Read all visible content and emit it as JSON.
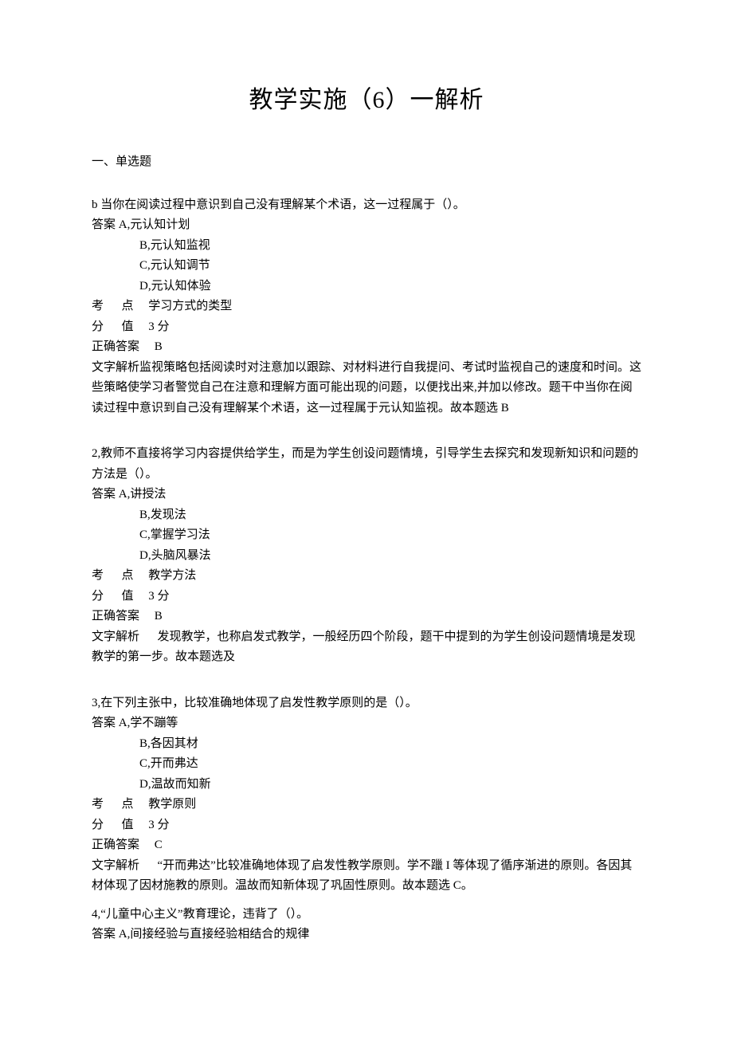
{
  "title": "教学实施（6）一解析",
  "section_header": "一、单选题",
  "questions": [
    {
      "stem": "b 当你在阅读过程中意识到自己没有理解某个术语，这一过程属于（）。",
      "opt_a": "答案 A,元认知计划",
      "opt_b": "B,元认知监视",
      "opt_c": "C,元认知调节",
      "opt_d": "D,元认知体验",
      "kaodian_label": "考",
      "kaodian_label2": "点",
      "kaodian": "学习方式的类型",
      "fenzhi_label": "分",
      "fenzhi_label2": "值",
      "fenzhi": "3 分",
      "answer_label": "正确答案",
      "answer": "B",
      "analysis": "文字解析监视策略包括阅读时对注意加以跟踪、对材料进行自我提问、考试时监视自己的速度和时间。这些策略使学习者警觉自己在注意和理解方面可能出现的问题，以便找出来,并加以修改。题干中当你在阅读过程中意识到自己没有理解某个术语，这一过程属于元认知监视。故本题选 B"
    },
    {
      "stem": "2,教师不直接将学习内容提供给学生，而是为学生创设问题情境，引导学生去探究和发现新知识和问题的方法是（）。",
      "opt_a": "答案 A,讲授法",
      "opt_b": "B,发现法",
      "opt_c": "C,掌握学习法",
      "opt_d": "D,头脑风暴法",
      "kaodian_label": "考",
      "kaodian_label2": "点",
      "kaodian": "教学方法",
      "fenzhi_label": "分",
      "fenzhi_label2": "值",
      "fenzhi": "3 分",
      "answer_label": "正确答案",
      "answer": "B",
      "analysis_label": "文字解析",
      "analysis": "发现教学，也称启发式教学，一般经历四个阶段，题干中提到的为学生创设问题情境是发现教学的第一步。故本题选及"
    },
    {
      "stem": "3,在下列主张中，比较准确地体现了启发性教学原则的是（）。",
      "opt_a": "答案 A,学不蹦等",
      "opt_b": "B,各因其材",
      "opt_c": "C,开而弗达",
      "opt_d": "D,温故而知新",
      "kaodian_label": "考",
      "kaodian_label2": "点",
      "kaodian": "教学原则",
      "fenzhi_label": "分",
      "fenzhi_label2": "值",
      "fenzhi": "3 分",
      "answer_label": "正确答案",
      "answer": "C",
      "analysis_label": "文字解析",
      "analysis": "“开而弗达”比较准确地体现了启发性教学原则。学不躐 I 等体现了循序渐进的原则。各因其材体现了因材施教的原则。温故而知新体现了巩固性原则。故本题选 C。"
    },
    {
      "stem": "4,“儿童中心主义”教育理论，违背了（）。",
      "opt_a": "答案 A,间接经验与直接经验相结合的规律"
    }
  ]
}
